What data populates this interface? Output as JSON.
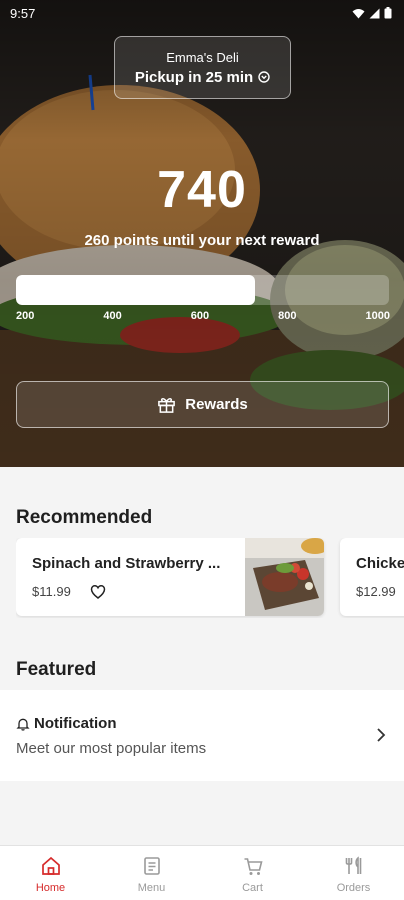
{
  "status_bar": {
    "time": "9:57"
  },
  "store": {
    "name": "Emma's Deli",
    "pickup_text": "Pickup in 25 min"
  },
  "rewards": {
    "points": "740",
    "subtitle": "260 points until your next reward",
    "progress_fraction": 0.64,
    "ticks": [
      "200",
      "400",
      "600",
      "800",
      "1000"
    ],
    "button_label": "Rewards"
  },
  "recommended": {
    "title": "Recommended",
    "items": [
      {
        "name": "Spinach and Strawberry ...",
        "price": "$11.99"
      },
      {
        "name": "Chicke",
        "price": "$12.99"
      }
    ]
  },
  "featured": {
    "title": "Featured",
    "notification_title": "Notification",
    "notification_subtitle": "Meet our most popular items"
  },
  "nav": {
    "items": [
      {
        "label": "Home",
        "icon": "home-icon",
        "active": true
      },
      {
        "label": "Menu",
        "icon": "menu-icon",
        "active": false
      },
      {
        "label": "Cart",
        "icon": "cart-icon",
        "active": false
      },
      {
        "label": "Orders",
        "icon": "orders-icon",
        "active": false
      }
    ]
  },
  "colors": {
    "accent": "#d62b2b",
    "inactive_nav": "#9a9a9a"
  }
}
